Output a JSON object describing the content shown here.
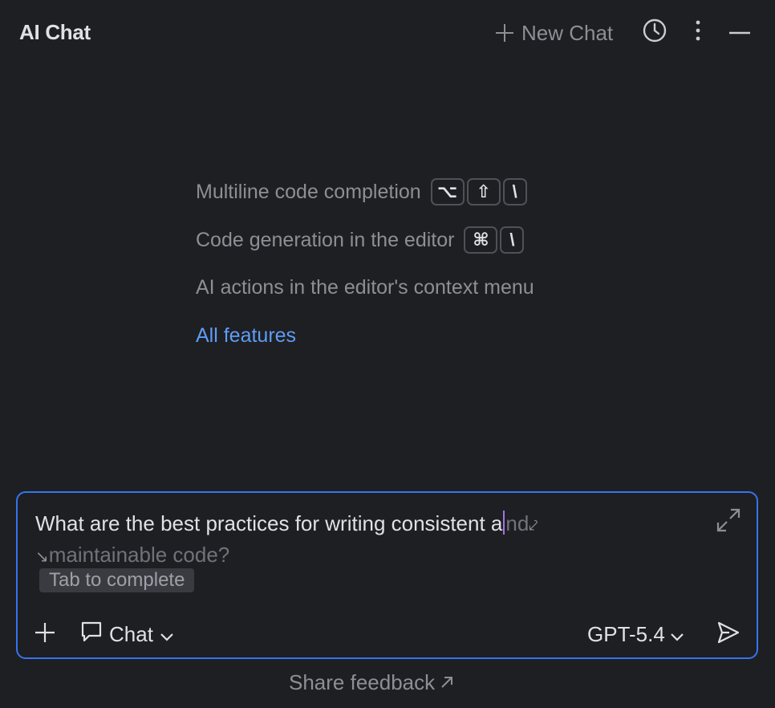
{
  "header": {
    "title": "AI Chat",
    "new_chat_label": "New Chat",
    "icons": [
      "plus-icon",
      "history-icon",
      "more-vertical-icon",
      "minimize-icon"
    ]
  },
  "features": {
    "items": [
      {
        "label": "Multiline code completion",
        "keys": [
          "⌥",
          "⇧",
          "\\"
        ]
      },
      {
        "label": "Code generation in the editor",
        "keys": [
          "⌘",
          "\\"
        ]
      },
      {
        "label": "AI actions in the editor's context menu",
        "keys": []
      }
    ],
    "all_features_link": "All features"
  },
  "input": {
    "typed_text": "What are the best practices for writing consistent a",
    "ghost_after_caret": "nd",
    "ghost_next_line": "maintainable code?",
    "completion_hint": "Tab to complete",
    "mode_label": "Chat",
    "model_label": "GPT-5.4",
    "icons": [
      "expand-icon",
      "plus-icon",
      "chat-bubble-icon",
      "chevron-down-icon",
      "send-icon"
    ]
  },
  "footer": {
    "share_feedback_label": "Share feedback"
  },
  "colors": {
    "background": "#1e1f22",
    "focus_border": "#3574f0",
    "link": "#5f9cf5",
    "caret": "#a571e6",
    "muted_text": "#8c8f94"
  }
}
